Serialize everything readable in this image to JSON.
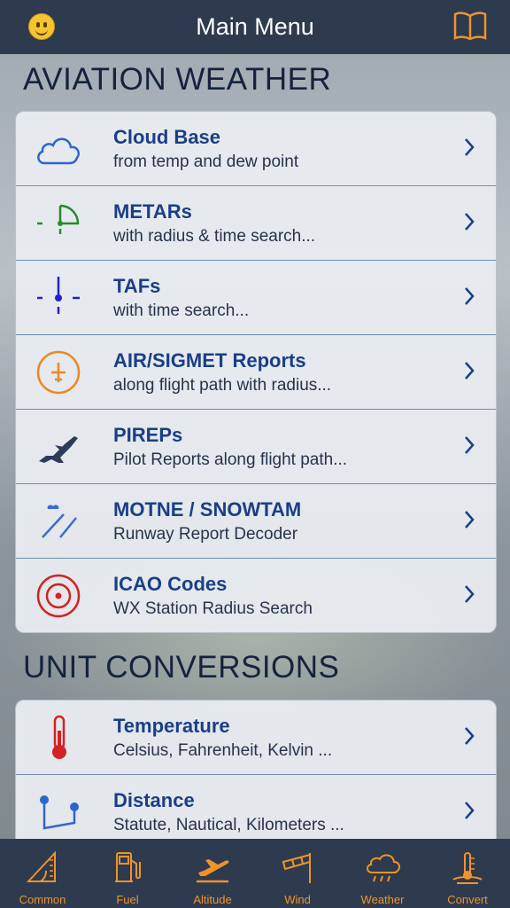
{
  "header": {
    "title": "Main Menu"
  },
  "sections": [
    {
      "title": "AVIATION WEATHER",
      "items": [
        {
          "title": "Cloud Base",
          "subtitle": "from temp and dew point",
          "icon": "cloud-icon"
        },
        {
          "title": "METARs",
          "subtitle": "with radius & time search...",
          "icon": "metar-station-icon"
        },
        {
          "title": "TAFs",
          "subtitle": "with time search...",
          "icon": "taf-station-icon"
        },
        {
          "title": "AIR/SIGMET Reports",
          "subtitle": "along flight path with radius...",
          "icon": "airplane-circle-icon"
        },
        {
          "title": "PIREPs",
          "subtitle": "Pilot Reports along flight path...",
          "icon": "airplane-icon"
        },
        {
          "title": "MOTNE / SNOWTAM",
          "subtitle": "Runway Report Decoder",
          "icon": "runway-snow-icon"
        },
        {
          "title": "ICAO Codes",
          "subtitle": "WX Station Radius Search",
          "icon": "target-icon"
        }
      ]
    },
    {
      "title": "UNIT CONVERSIONS",
      "items": [
        {
          "title": "Temperature",
          "subtitle": "Celsius, Fahrenheit, Kelvin ...",
          "icon": "thermometer-icon"
        },
        {
          "title": "Distance",
          "subtitle": "Statute, Nautical, Kilometers ...",
          "icon": "distance-icon"
        }
      ]
    }
  ],
  "tabs": [
    {
      "label": "Common",
      "icon": "protractor-icon"
    },
    {
      "label": "Fuel",
      "icon": "fuel-pump-icon"
    },
    {
      "label": "Altitude",
      "icon": "takeoff-icon"
    },
    {
      "label": "Wind",
      "icon": "windsock-icon"
    },
    {
      "label": "Weather",
      "icon": "rain-cloud-icon"
    },
    {
      "label": "Convert",
      "icon": "gauge-icon"
    }
  ],
  "colors": {
    "accent": "#f0932a",
    "bar": "#2e3a4e",
    "title_blue": "#1a3f86"
  }
}
